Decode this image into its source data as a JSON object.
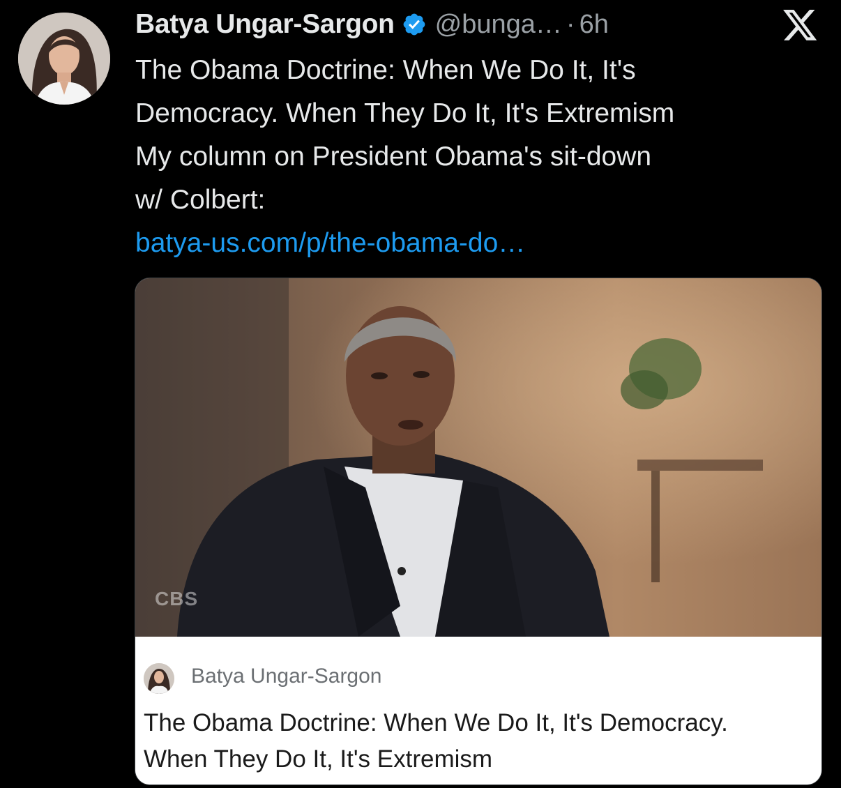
{
  "author": {
    "name": "Batya Ungar-Sargon",
    "handle": "@bunga…",
    "separator": "·",
    "time": "6h"
  },
  "platform_icon": "x-logo-icon",
  "tweet": {
    "lines": [
      "The Obama Doctrine: When We Do It, It's",
      "Democracy. When They Do It, It's Extremism",
      "My column on President Obama's sit-down",
      "w/ Colbert:"
    ],
    "link": "batya-us.com/p/the-obama-do…"
  },
  "card": {
    "image_watermark": "CBS",
    "publication_name": "Batya Ungar-Sargon",
    "title_lines": [
      "The Obama Doctrine: When We Do It, It's Democracy.",
      "When They Do It, It's Extremism"
    ]
  },
  "colors": {
    "background": "#000000",
    "primary_text": "#e7e9ea",
    "secondary_text": "#9ba1a6",
    "link": "#1d9bf0",
    "verified": "#1d9bf0"
  }
}
